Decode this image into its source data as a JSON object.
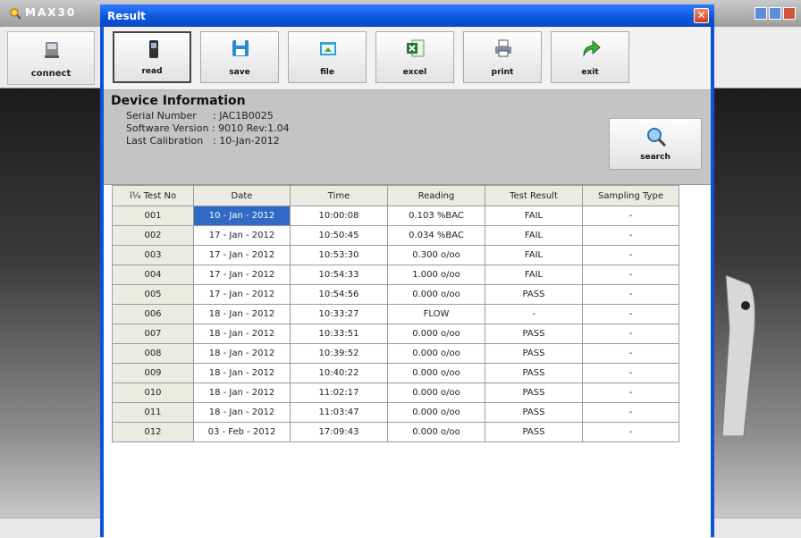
{
  "background_app": {
    "title": "MAX30",
    "connect_label": "connect"
  },
  "dialog": {
    "title": "Result",
    "close_glyph": "✕"
  },
  "toolbar": {
    "buttons": [
      {
        "label": "read",
        "icon": "device-icon"
      },
      {
        "label": "save",
        "icon": "floppy-disk-icon"
      },
      {
        "label": "file",
        "icon": "folder-icon"
      },
      {
        "label": "excel",
        "icon": "excel-icon"
      },
      {
        "label": "print",
        "icon": "printer-icon"
      },
      {
        "label": "exit",
        "icon": "exit-arrow-icon"
      }
    ]
  },
  "device_info": {
    "heading": "Device Information",
    "serial_label": "Serial Number",
    "serial_value": ": JAC1B0025",
    "software_label": "Software Version",
    "software_value": ": 9010 Rev:1.04",
    "calibration_label": "Last Calibration",
    "calibration_value": ": 10-Jan-2012",
    "search_label": "search"
  },
  "table": {
    "columns": [
      "ï¼ Test No",
      "Date",
      "Time",
      "Reading",
      "Test Result",
      "Sampling Type"
    ],
    "rows": [
      [
        "001",
        "10 - Jan - 2012",
        "10:00:08",
        "0.103 %BAC",
        "FAIL",
        "-"
      ],
      [
        "002",
        "17 - Jan - 2012",
        "10:50:45",
        "0.034 %BAC",
        "FAIL",
        "-"
      ],
      [
        "003",
        "17 - Jan - 2012",
        "10:53:30",
        "0.300 o/oo",
        "FAIL",
        "-"
      ],
      [
        "004",
        "17 - Jan - 2012",
        "10:54:33",
        "1.000 o/oo",
        "FAIL",
        "-"
      ],
      [
        "005",
        "17 - Jan - 2012",
        "10:54:56",
        "0.000 o/oo",
        "PASS",
        "-"
      ],
      [
        "006",
        "18 - Jan - 2012",
        "10:33:27",
        "FLOW",
        "-",
        "-"
      ],
      [
        "007",
        "18 - Jan - 2012",
        "10:33:51",
        "0.000 o/oo",
        "PASS",
        "-"
      ],
      [
        "008",
        "18 - Jan - 2012",
        "10:39:52",
        "0.000 o/oo",
        "PASS",
        "-"
      ],
      [
        "009",
        "18 - Jan - 2012",
        "10:40:22",
        "0.000 o/oo",
        "PASS",
        "-"
      ],
      [
        "010",
        "18 - Jan - 2012",
        "11:02:17",
        "0.000 o/oo",
        "PASS",
        "-"
      ],
      [
        "011",
        "18 - Jan - 2012",
        "11:03:47",
        "0.000 o/oo",
        "PASS",
        "-"
      ],
      [
        "012",
        "03 - Feb - 2012",
        "17:09:43",
        "0.000 o/oo",
        "PASS",
        "-"
      ]
    ]
  },
  "colors": {
    "titlebar_blue": "#0a54d8",
    "selected_cell": "#316ac5",
    "info_panel": "#c4c4c4"
  }
}
